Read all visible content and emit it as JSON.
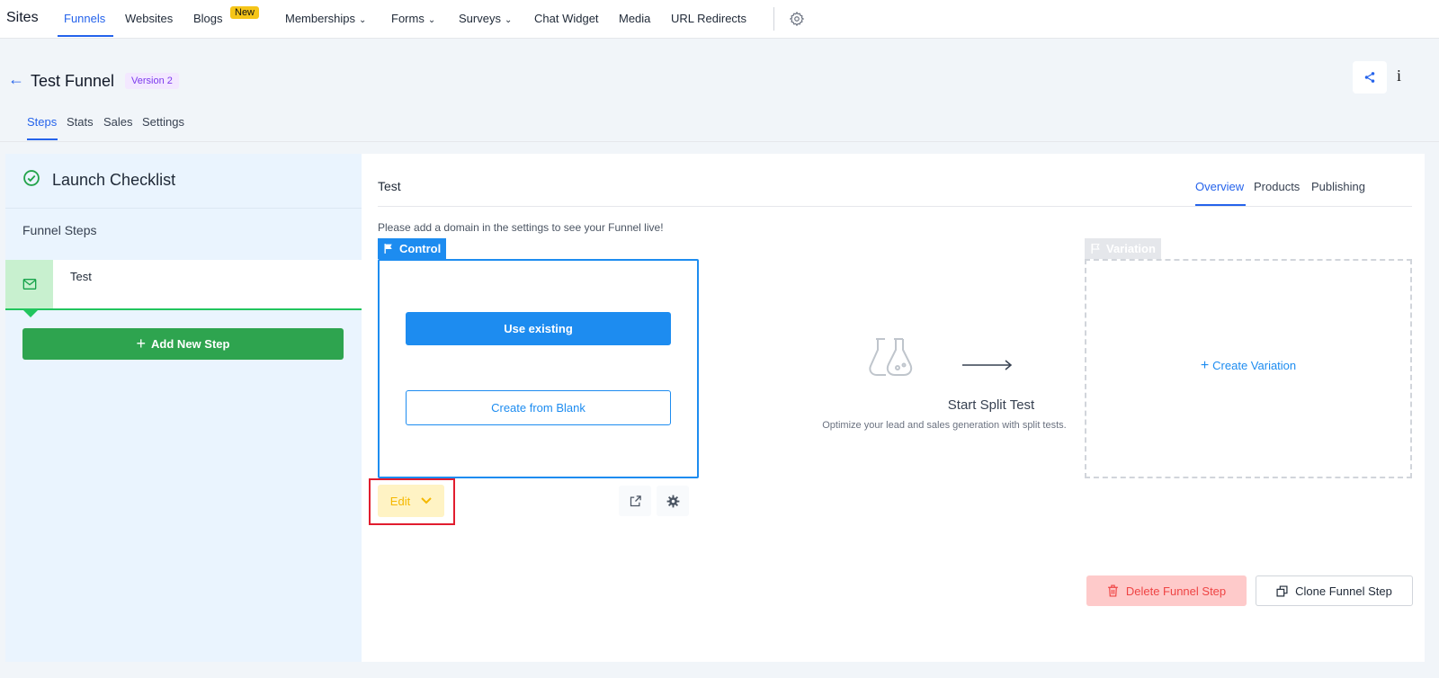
{
  "topnav": {
    "brand": "Sites",
    "items": [
      {
        "label": "Funnels"
      },
      {
        "label": "Websites"
      },
      {
        "label": "Blogs",
        "badge": "New"
      },
      {
        "label": "Memberships"
      },
      {
        "label": "Forms"
      },
      {
        "label": "Surveys"
      },
      {
        "label": "Chat Widget"
      },
      {
        "label": "Media"
      },
      {
        "label": "URL Redirects"
      }
    ],
    "settings_icon": "gear-icon"
  },
  "header": {
    "title": "Test Funnel",
    "version": "Version 2",
    "info_label": "i",
    "tabs": [
      {
        "label": "Steps"
      },
      {
        "label": "Stats"
      },
      {
        "label": "Sales"
      },
      {
        "label": "Settings"
      }
    ]
  },
  "sidebar": {
    "checklist_title": "Launch Checklist",
    "steps_label": "Funnel Steps",
    "steps": [
      {
        "name": "Test"
      }
    ],
    "add_step_label": "Add New Step"
  },
  "main": {
    "title": "Test",
    "tabs": [
      {
        "label": "Overview"
      },
      {
        "label": "Products"
      },
      {
        "label": "Publishing"
      }
    ],
    "domain_message": "Please add a domain in the settings to see your Funnel live!",
    "control": {
      "tag": "Control",
      "use_existing": "Use existing",
      "create_blank": "Create from Blank",
      "edit_label": "Edit"
    },
    "split_test": {
      "title": "Start Split Test",
      "subtitle": "Optimize your lead and sales generation with split tests."
    },
    "variation": {
      "tag": "Variation",
      "create_label": "Create Variation"
    },
    "delete_label": "Delete Funnel Step",
    "clone_label": "Clone Funnel Step"
  },
  "colors": {
    "accent": "#1d8cf0",
    "success": "#2ea44f",
    "danger": "#ef4444",
    "warning": "#f5b800"
  }
}
